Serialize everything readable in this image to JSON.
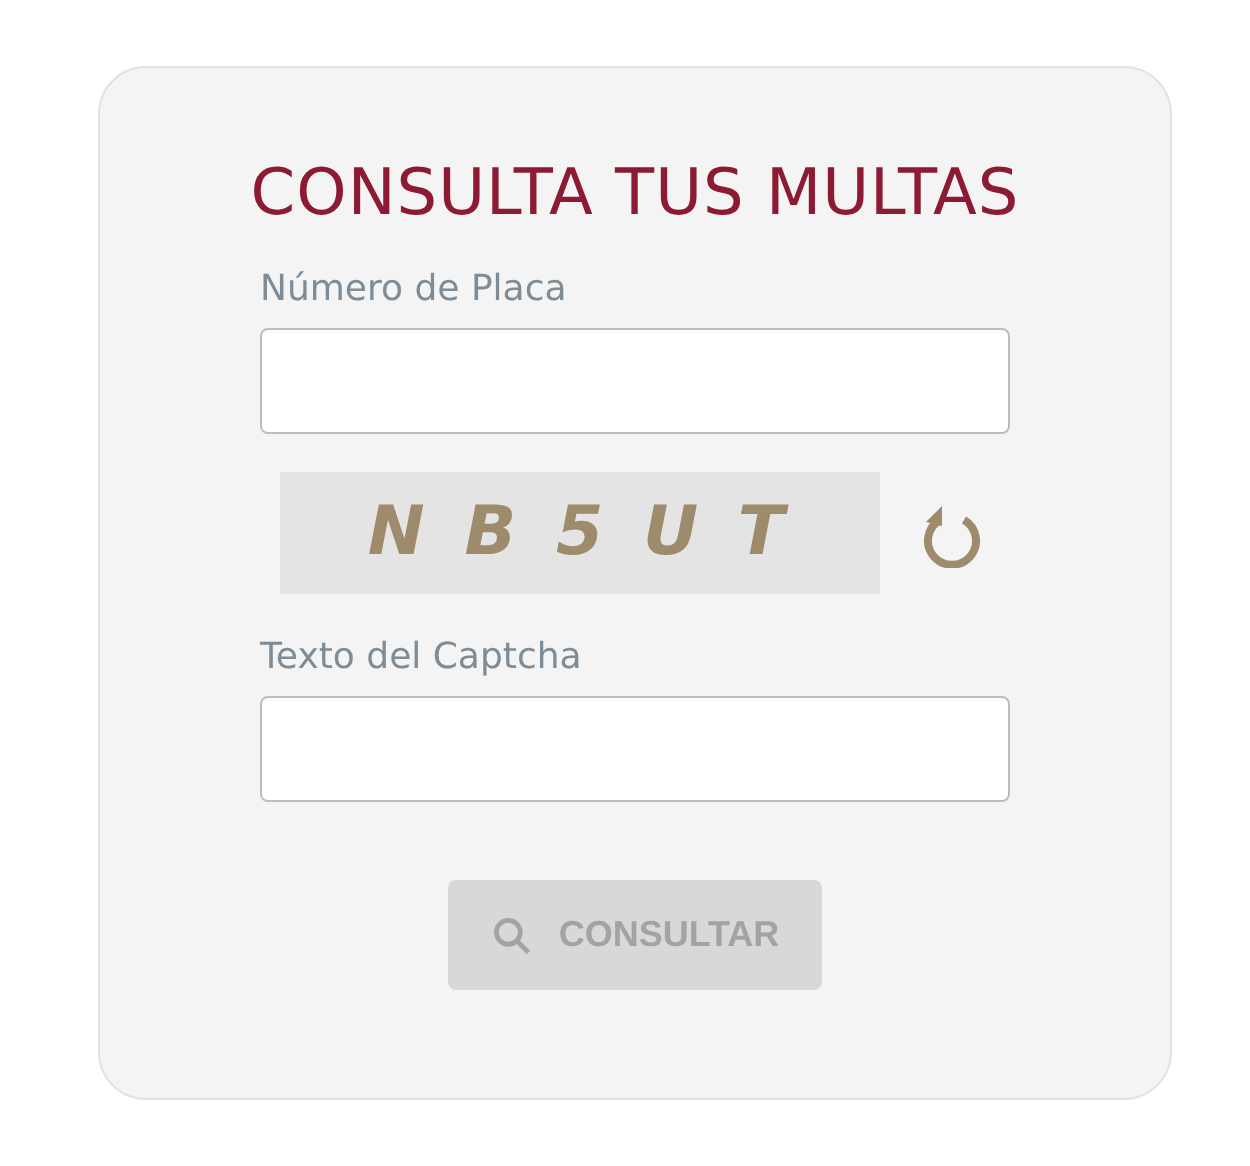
{
  "title": "CONSULTA TUS MULTAS",
  "plate_field": {
    "label": "Número de Placa"
  },
  "captcha": {
    "text": "N B 5 U T"
  },
  "captcha_field": {
    "label": "Texto del Captcha"
  },
  "submit_button": {
    "label": "CONSULTAR",
    "disabled": true
  }
}
